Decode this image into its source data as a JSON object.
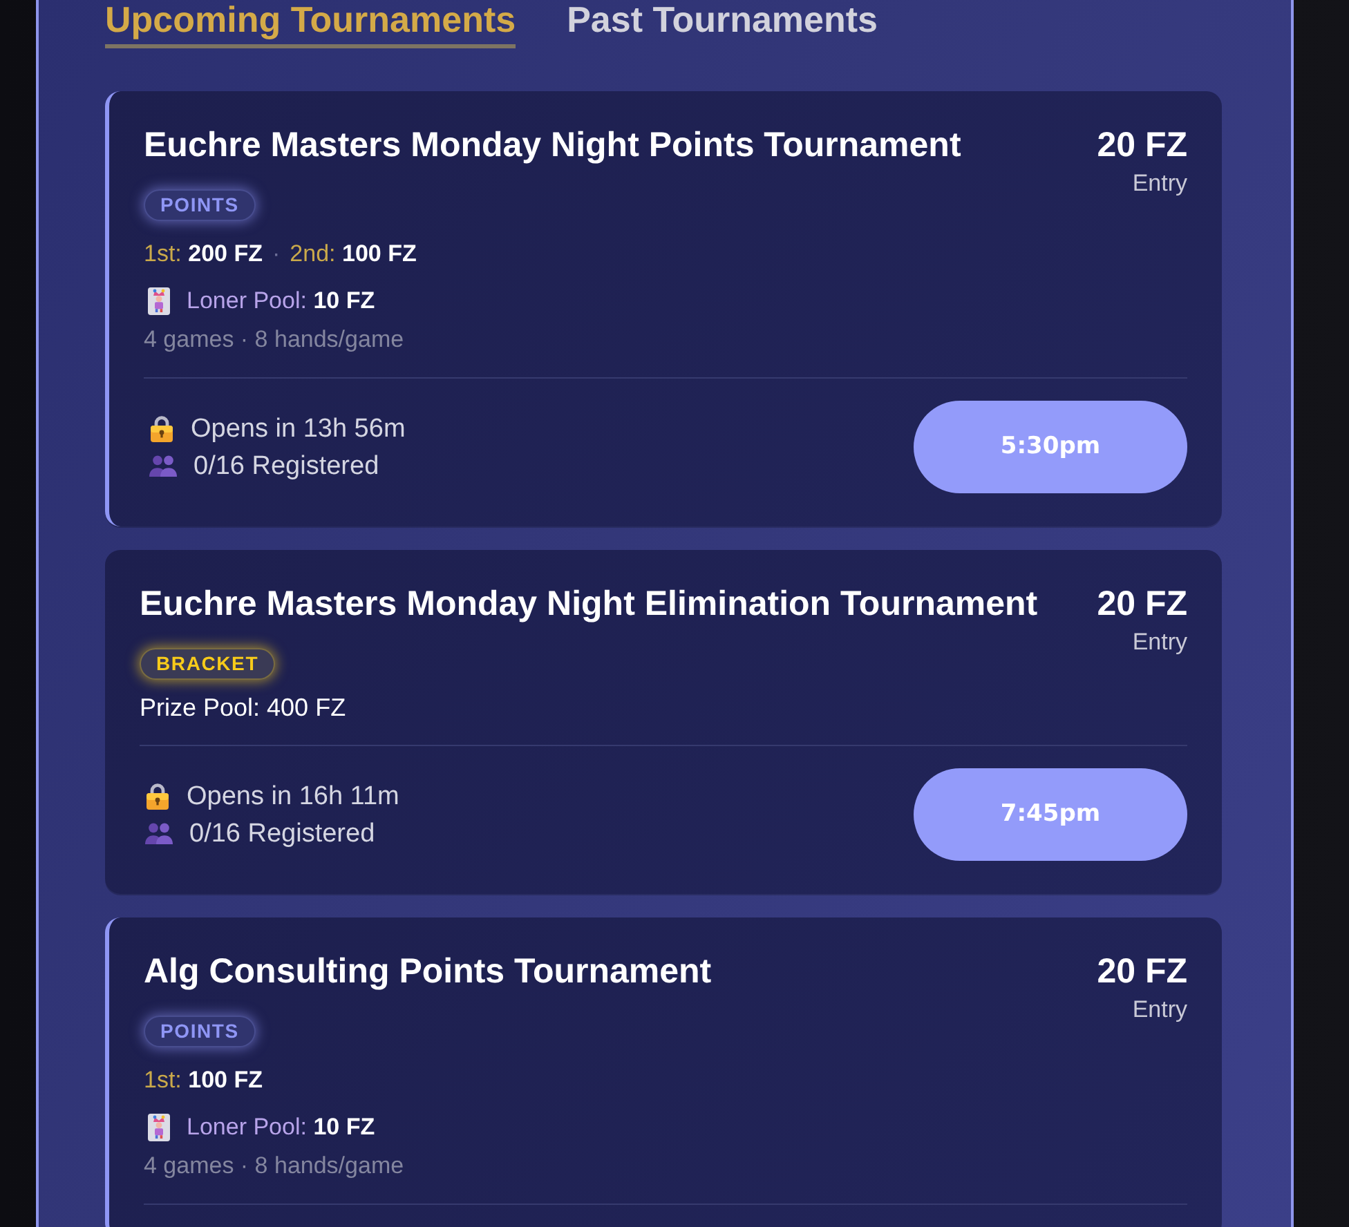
{
  "tabs": [
    {
      "label": "Upcoming Tournaments",
      "selected": true
    },
    {
      "label": "Past Tournaments",
      "selected": false
    }
  ],
  "tournaments": [
    {
      "kind": "points",
      "title": "Euchre Masters Monday Night Points Tournament",
      "entry_fee": "20 FZ",
      "entry_label": "Entry",
      "badge": "POINTS",
      "prizes": [
        {
          "place": "1st:",
          "amount": "200 FZ"
        },
        {
          "place": "2nd:",
          "amount": "100 FZ"
        }
      ],
      "prize_separator": "·",
      "loner_pool": {
        "label": "Loner Pool:",
        "amount": "10 FZ"
      },
      "format": "4 games · 8 hands/game",
      "opens": "Opens in 13h 56m",
      "registered": "0/16 Registered",
      "start_time": "5:30pm"
    },
    {
      "kind": "bracket",
      "title": "Euchre Masters Monday Night Elimination Tournament",
      "entry_fee": "20 FZ",
      "entry_label": "Entry",
      "badge": "BRACKET",
      "prize_pool": "Prize Pool: 400 FZ",
      "opens": "Opens in 16h 11m",
      "registered": "0/16 Registered",
      "start_time": "7:45pm"
    },
    {
      "kind": "points",
      "title": "Alg Consulting Points Tournament",
      "entry_fee": "20 FZ",
      "entry_label": "Entry",
      "badge": "POINTS",
      "prizes": [
        {
          "place": "1st:",
          "amount": "100 FZ"
        }
      ],
      "loner_pool": {
        "label": "Loner Pool:",
        "amount": "10 FZ"
      },
      "format": "4 games · 8 hands/game"
    }
  ]
}
